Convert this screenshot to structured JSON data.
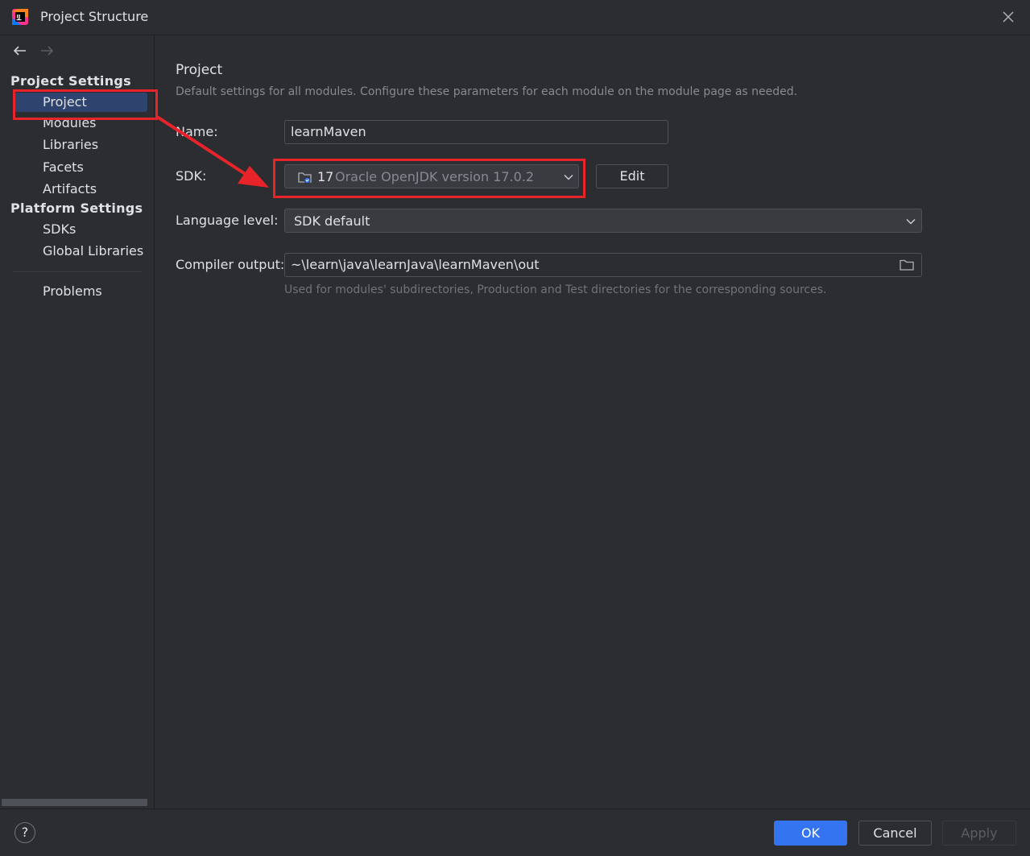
{
  "window": {
    "title": "Project Structure"
  },
  "sidebar": {
    "sections": [
      {
        "header": "Project Settings",
        "items": [
          "Project",
          "Modules",
          "Libraries",
          "Facets",
          "Artifacts"
        ]
      },
      {
        "header": "Platform Settings",
        "items": [
          "SDKs",
          "Global Libraries"
        ]
      }
    ],
    "other_items": [
      "Problems"
    ],
    "selected": "Project"
  },
  "main": {
    "title": "Project",
    "description": "Default settings for all modules. Configure these parameters for each module on the module page as needed.",
    "name_label": "Name:",
    "name_value": "learnMaven",
    "sdk_label": "SDK:",
    "sdk_version": "17",
    "sdk_detail": "Oracle OpenJDK version 17.0.2",
    "edit_label": "Edit",
    "language_level_label": "Language level:",
    "language_level_value": "SDK default",
    "compiler_output_label": "Compiler output:",
    "compiler_output_value": "~\\learn\\java\\learnJava\\learnMaven\\out",
    "compiler_output_hint": "Used for modules' subdirectories, Production and Test directories for the corresponding sources."
  },
  "footer": {
    "help_label": "?",
    "ok_label": "OK",
    "cancel_label": "Cancel",
    "apply_label": "Apply"
  },
  "colors": {
    "background": "#2b2d30",
    "selection": "#2e436e",
    "accent": "#3574f0",
    "annotation": "#e8242a"
  },
  "icons": [
    "app-logo-icon",
    "close-icon",
    "back-arrow-icon",
    "forward-arrow-icon",
    "jdk-folder-icon",
    "chevron-down-icon",
    "folder-icon",
    "help-icon"
  ]
}
